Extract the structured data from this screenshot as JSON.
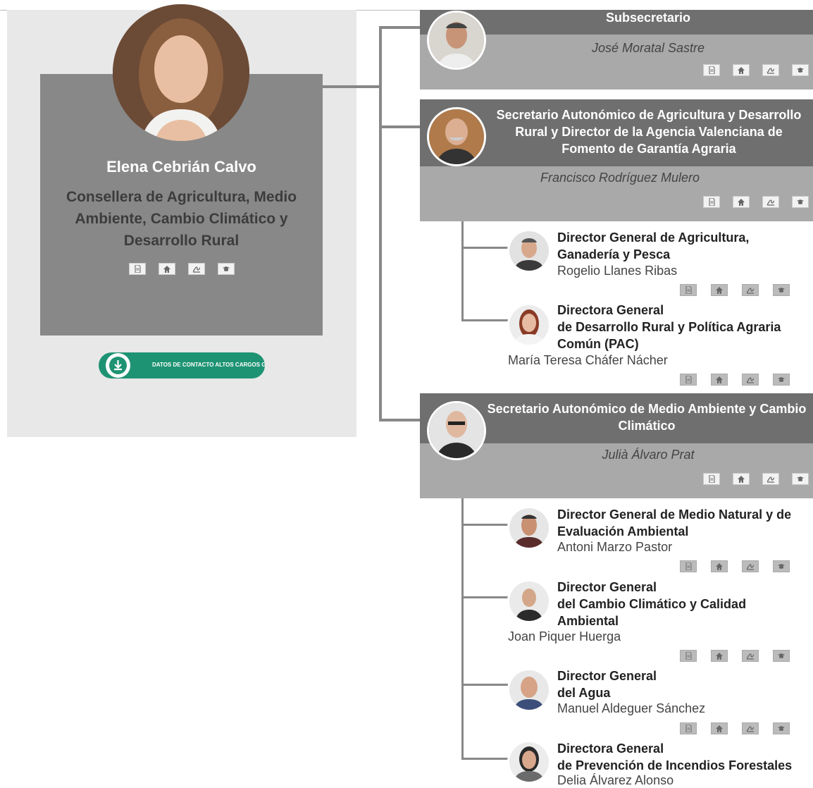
{
  "conseller": {
    "name": "Elena Cebrián Calvo",
    "role": "Consellera de Agricultura, Medio Ambiente, Cambio Climático y Desarrollo Rural"
  },
  "download_button": {
    "label": "DATOS DE CONTACTO ALTOS CARGOS GVA"
  },
  "subsecretario": {
    "title": "Subsecretario",
    "person": "José Moratal Sastre"
  },
  "secretario_agricultura": {
    "title": "Secretario Autonómico de Agricultura y Desarrollo Rural y Director de la Agencia Valenciana de Fomento de Garantía Agraria",
    "person": "Francisco Rodríguez Mulero"
  },
  "dg_agricultura": {
    "title_line1": "Director General de Agricultura,",
    "title_line2": "Ganadería y Pesca",
    "person": "Rogelio Llanes Ribas"
  },
  "dg_desarrollo_rural": {
    "title_line1": "Directora General",
    "title_line2": "de Desarrollo Rural y Política Agraria",
    "title_line3": "Común (PAC)",
    "person": "María Teresa Cháfer Nácher"
  },
  "secretario_medio_ambiente": {
    "title": "Secretario Autonómico de Medio Ambiente y Cambio Climático",
    "person": "Julià Álvaro Prat"
  },
  "dg_medio_natural": {
    "title_line1": "Director General de Medio Natural y de",
    "title_line2": "Evaluación Ambiental",
    "person": "Antoni Marzo Pastor"
  },
  "dg_cambio_climatico": {
    "title_line1": "Director General",
    "title_line2": "del Cambio Climático y Calidad",
    "title_line3": "Ambiental",
    "person": "Joan Piquer Huerga"
  },
  "dg_agua": {
    "title_line1": "Director General",
    "title_line2": "del Agua",
    "person": "Manuel Aldeguer Sánchez"
  },
  "dg_incendios": {
    "title_line1": "Directora General",
    "title_line2": "de Prevención de Incendios Forestales",
    "person": "Delia Álvarez Alonso"
  },
  "icons": [
    "document-icon",
    "home-icon",
    "signature-icon",
    "hat-icon"
  ]
}
